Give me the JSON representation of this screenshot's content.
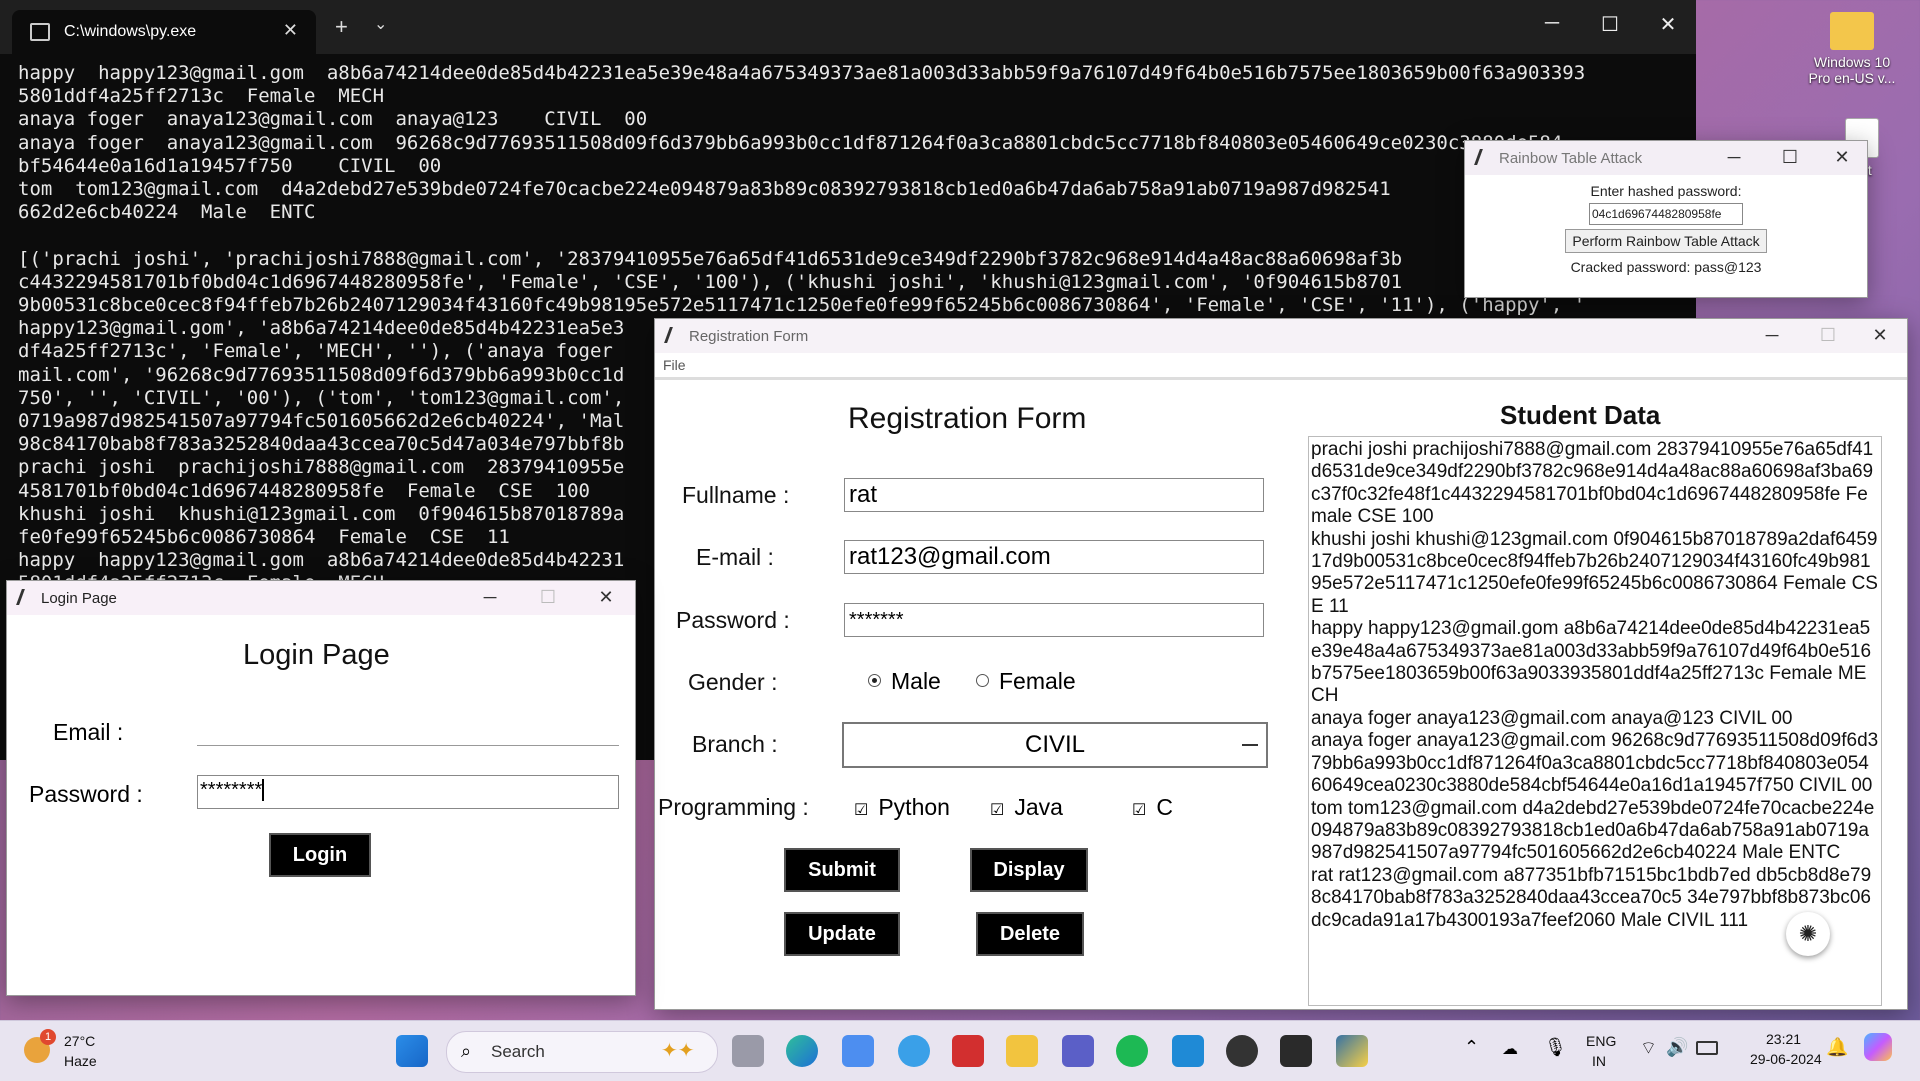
{
  "desktop": {
    "icons": [
      {
        "label": "Windows 10 Pro en-US v..."
      },
      {
        "label": "ent"
      }
    ]
  },
  "terminal": {
    "tab_title": "C:\\windows\\py.exe",
    "lines": [
      "happy  happy123@gmail.gom  a8b6a74214dee0de85d4b42231ea5e39e48a4a675349373ae81a003d33abb59f9a76107d49f64b0e516b7575ee1803659b00f63a903393",
      "5801ddf4a25ff2713c  Female  MECH",
      "anaya foger  anaya123@gmail.com  anaya@123    CIVIL  00",
      "anaya foger  anaya123@gmail.com  96268c9d77693511508d09f6d379bb6a993b0cc1df871264f0a3ca8801cbdc5cc7718bf840803e05460649ce0230c3880de584",
      "bf54644e0a16d1a19457f750    CIVIL  00",
      "tom  tom123@gmail.com  d4a2debd27e539bde0724fe70cacbe224e094879a83b89c08392793818cb1ed0a6b47da6ab758a91ab0719a987d982541",
      "662d2e6cb40224  Male  ENTC",
      "",
      "[('prachi joshi', 'prachijoshi7888@gmail.com', '28379410955e76a65df41d6531de9ce349df2290bf3782c968e914d4a48ac88a60698af3b",
      "c4432294581701bf0bd04c1d6967448280958fe', 'Female', 'CSE', '100'), ('khushi joshi', 'khushi@123gmail.com', '0f904615b8701",
      "9b00531c8bce0cec8f94ffeb7b26b2407129034f43160fc49b98195e572e5117471c1250efe0fe99f65245b6c0086730864', 'Female', 'CSE', '11'), ('happy', '",
      "happy123@gmail.gom', 'a8b6a74214dee0de85d4b42231ea5e3",
      "df4a25ff2713c', 'Female', 'MECH', ''), ('anaya foger",
      "mail.com', '96268c9d77693511508d09f6d379bb6a993b0cc1d",
      "750', '', 'CIVIL', '00'), ('tom', 'tom123@gmail.com',",
      "0719a987d982541507a97794fc501605662d2e6cb40224', 'Mal",
      "98c84170bab8f783a3252840daa43ccea70c5d47a034e797bbf8b",
      "prachi joshi  prachijoshi7888@gmail.com  28379410955e",
      "4581701bf0bd04c1d6967448280958fe  Female  CSE  100",
      "khushi joshi  khushi@123gmail.com  0f904615b87018789a",
      "fe0fe99f65245b6c0086730864  Female  CSE  11",
      "happy  happy123@gmail.gom  a8b6a74214dee0de85d4b42231",
      "5801ddf4a25ff2713c  Female  MECH"
    ]
  },
  "rainbow": {
    "title": "Rainbow Table Attack",
    "prompt": "Enter hashed password:",
    "hash_value": "04c1d6967448280958fe",
    "button": "Perform Rainbow Table Attack",
    "result": "Cracked password: pass@123"
  },
  "registration": {
    "title": "Registration Form",
    "menu_file": "File",
    "heading": "Registration Form",
    "data_heading": "Student Data",
    "labels": {
      "fullname": "Fullname :",
      "email": "E-mail :",
      "password": "Password :",
      "gender": "Gender :",
      "branch": "Branch :",
      "programming": "Programming :"
    },
    "values": {
      "fullname": "rat",
      "email": "rat123@gmail.com",
      "password": "*******",
      "branch": "CIVIL"
    },
    "gender_options": {
      "male": "Male",
      "female": "Female"
    },
    "programming_options": {
      "python": "Python",
      "java": "Java",
      "c": "C"
    },
    "buttons": {
      "submit": "Submit",
      "display": "Display",
      "update": "Update",
      "delete": "Delete"
    },
    "student_data": "prachi joshi prachijoshi7888@gmail.com 28379410955e76a65df41d6531de9ce349df2290bf3782c968e914d4a48ac88a60698af3ba69c37f0c32fe48f1c4432294581701bf0bd04c1d6967448280958fe Female CSE 100\nkhushi joshi khushi@123gmail.com 0f904615b87018789a2daf645917d9b00531c8bce0cec8f94ffeb7b26b2407129034f43160fc49b98195e572e5117471c1250efe0fe99f65245b6c0086730864 Female CSE 11\nhappy happy123@gmail.gom a8b6a74214dee0de85d4b42231ea5e39e48a4a675349373ae81a003d33abb59f9a76107d49f64b0e516b7575ee1803659b00f63a9033935801ddf4a25ff2713c Female MECH\nanaya foger anaya123@gmail.com anaya@123  CIVIL 00\nanaya foger anaya123@gmail.com 96268c9d77693511508d09f6d379bb6a993b0cc1df871264f0a3ca8801cbdc5cc7718bf840803e05460649cea0230c3880de584cbf54644e0a16d1a19457f750  CIVIL 00\ntom tom123@gmail.com d4a2debd27e539bde0724fe70cacbe224e094879a83b89c08392793818cb1ed0a6b47da6ab758a91ab0719a987d982541507a97794fc501605662d2e6cb40224 Male ENTC\nrat rat123@gmail.com a877351bfb71515bc1bdb7ed db5cb8d8e798c84170bab8f783a3252840daa43ccea70c5 34e797bbf8b873bc06dc9cada91a17b4300193a7feef2060 Male CIVIL 111"
  },
  "login": {
    "title": "Login Page",
    "heading": "Login Page",
    "email_label": "Email :",
    "password_label": "Password :",
    "password_value": "********",
    "button": "Login"
  },
  "taskbar": {
    "weather_temp": "27°C",
    "weather_desc": "Haze",
    "weather_badge": "1",
    "search": "Search",
    "lang": "ENG",
    "region": "IN",
    "time": "23:21",
    "date": "29-06-2024"
  }
}
